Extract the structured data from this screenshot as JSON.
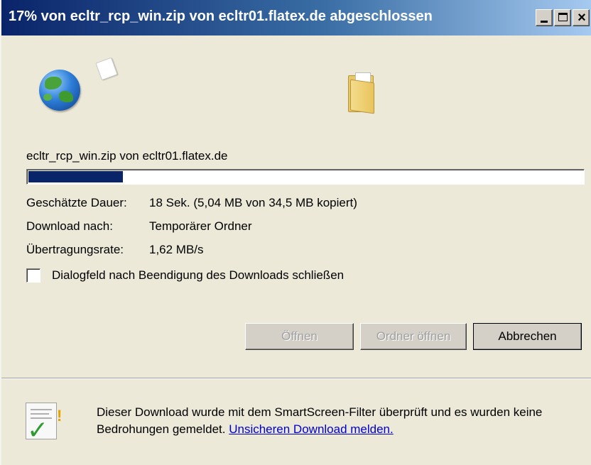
{
  "window": {
    "title": "17% von ecltr_rcp_win.zip von ecltr01.flatex.de abgeschlossen"
  },
  "download": {
    "filename": "ecltr_rcp_win.zip von ecltr01.flatex.de",
    "progress_percent": 17,
    "estimated_label": "Geschätzte Dauer:",
    "estimated_value": "18 Sek. (5,04 MB von 34,5 MB kopiert)",
    "target_label": "Download nach:",
    "target_value": "Temporärer Ordner",
    "rate_label": "Übertragungsrate:",
    "rate_value": "1,62 MB/s"
  },
  "close_on_finish": {
    "label": "Dialogfeld nach Beendigung des Downloads schließen",
    "checked": false
  },
  "buttons": {
    "open": "Öffnen",
    "open_folder": "Ordner öffnen",
    "cancel": "Abbrechen"
  },
  "footer": {
    "text": "Dieser Download wurde mit dem SmartScreen-Filter überprüft und es wurden keine Bedrohungen gemeldet.",
    "link": "Unsicheren Download melden."
  },
  "icons": {
    "globe": "globe-icon",
    "paper": "document-icon",
    "folder": "folder-icon",
    "smartscreen": "smartscreen-check-icon"
  },
  "colors": {
    "titlebar_start": "#0a246a",
    "progress_fill": "#0a246a",
    "link": "#0000cc"
  }
}
